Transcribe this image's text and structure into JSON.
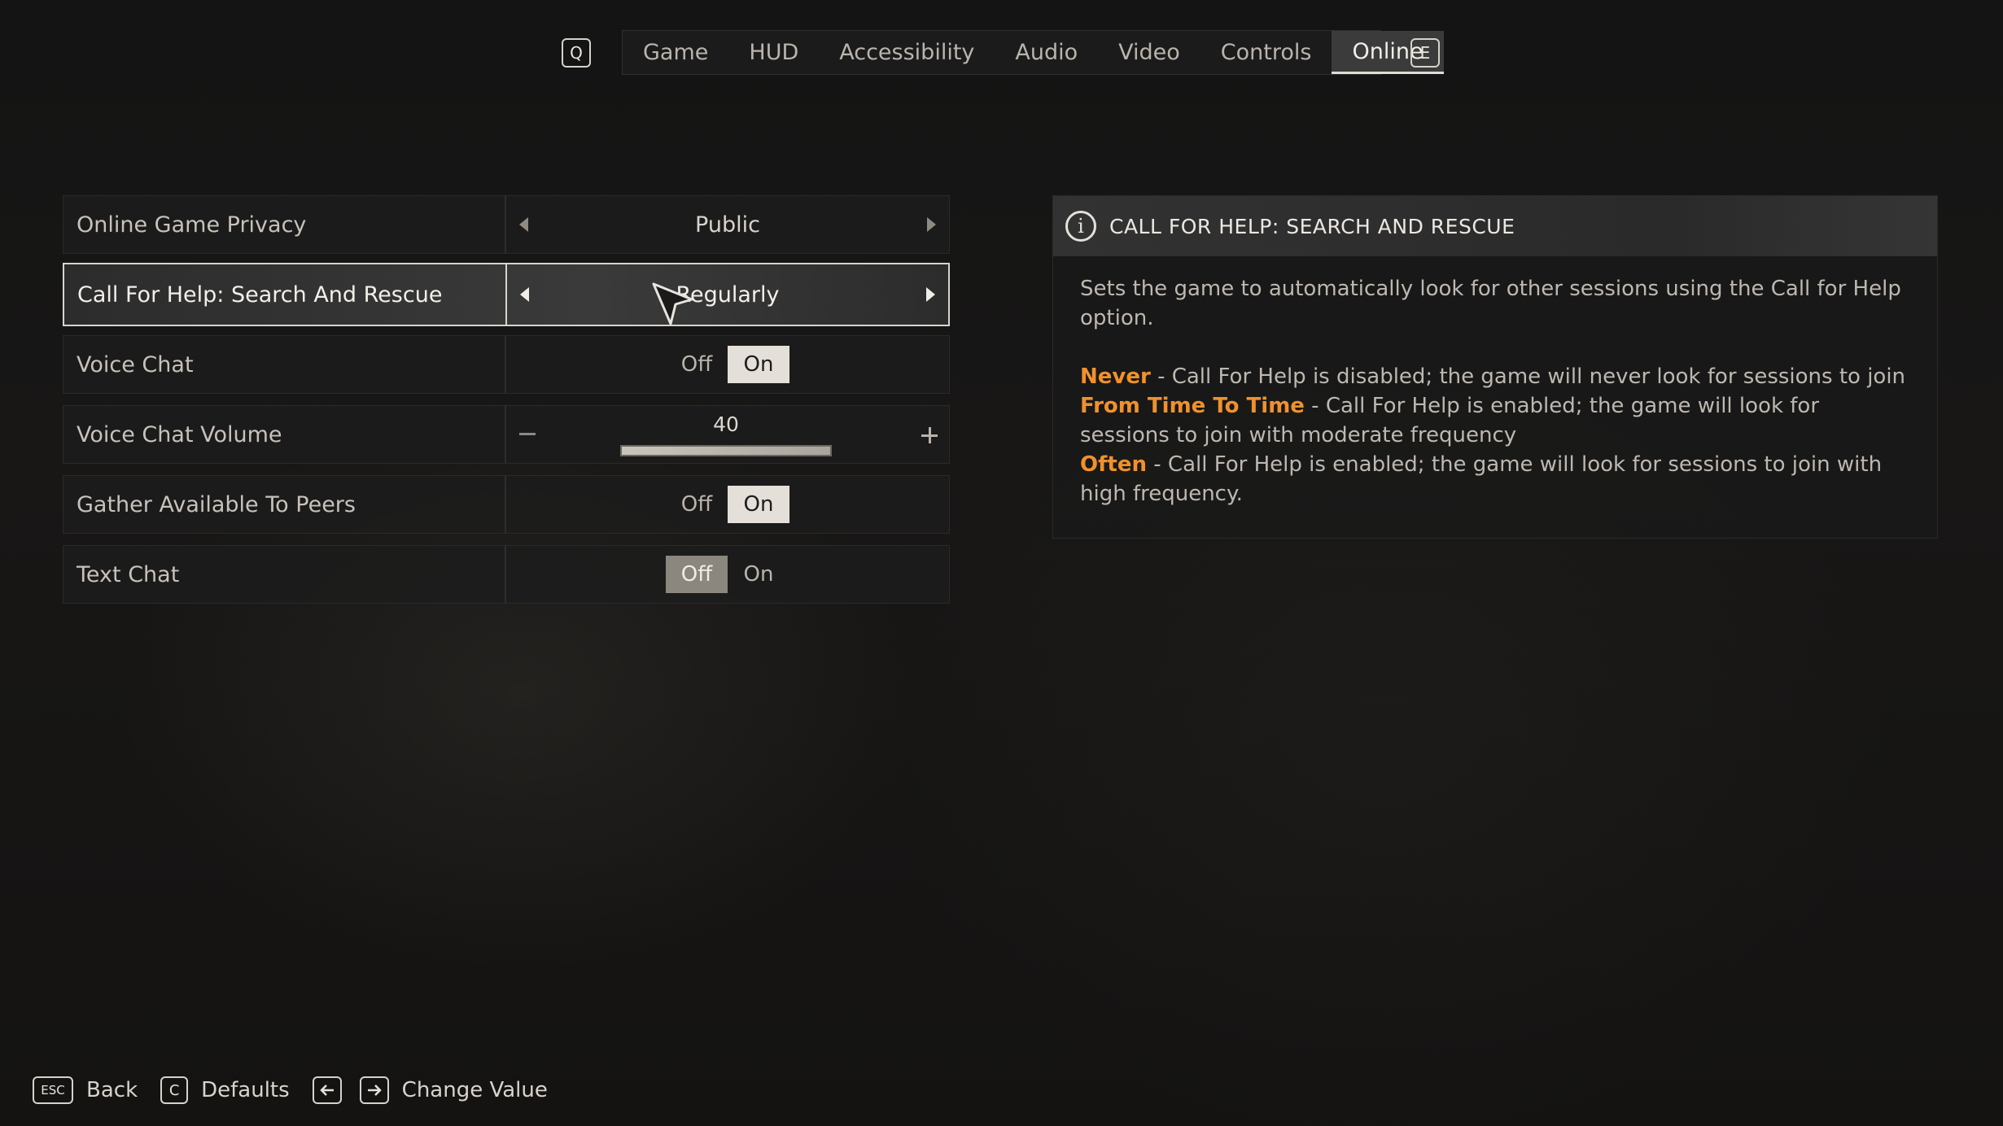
{
  "tabs": {
    "prev_key": "Q",
    "next_key": "E",
    "items": [
      {
        "label": "Game",
        "active": false
      },
      {
        "label": "HUD",
        "active": false
      },
      {
        "label": "Accessibility",
        "active": false
      },
      {
        "label": "Audio",
        "active": false
      },
      {
        "label": "Video",
        "active": false
      },
      {
        "label": "Controls",
        "active": false
      },
      {
        "label": "Online",
        "active": true
      }
    ]
  },
  "settings": {
    "privacy": {
      "label": "Online Game Privacy",
      "value": "Public"
    },
    "call_for_help": {
      "label": "Call For Help: Search And Rescue",
      "value": "Regularly"
    },
    "voice_chat": {
      "label": "Voice Chat",
      "off": "Off",
      "on": "On",
      "selected": "On"
    },
    "voice_chat_volume": {
      "label": "Voice Chat Volume",
      "value": "40",
      "fraction": 1.0
    },
    "gather_available": {
      "label": "Gather Available To Peers",
      "off": "Off",
      "on": "On",
      "selected": "On"
    },
    "text_chat": {
      "label": "Text Chat",
      "off": "Off",
      "on": "On",
      "selected": "Off"
    }
  },
  "info": {
    "icon": "info-icon",
    "title": "CALL FOR HELP: SEARCH AND RESCUE",
    "description": "Sets the game to automatically look for other sessions using the Call for Help option.",
    "options": [
      {
        "name": "Never",
        "text": " - Call For Help is disabled; the game will never look for sessions to join"
      },
      {
        "name": "From Time To Time",
        "text": " - Call For Help is enabled; the game will look for sessions to join with moderate frequency"
      },
      {
        "name": "Often",
        "text": " - Call For Help is enabled; the game will look for sessions to join with high frequency."
      }
    ],
    "highlight_color": "#f0912c"
  },
  "hints": {
    "back_key": "ESC",
    "back_label": "Back",
    "defaults_key": "C",
    "defaults_label": "Defaults",
    "change_label": "Change Value"
  }
}
